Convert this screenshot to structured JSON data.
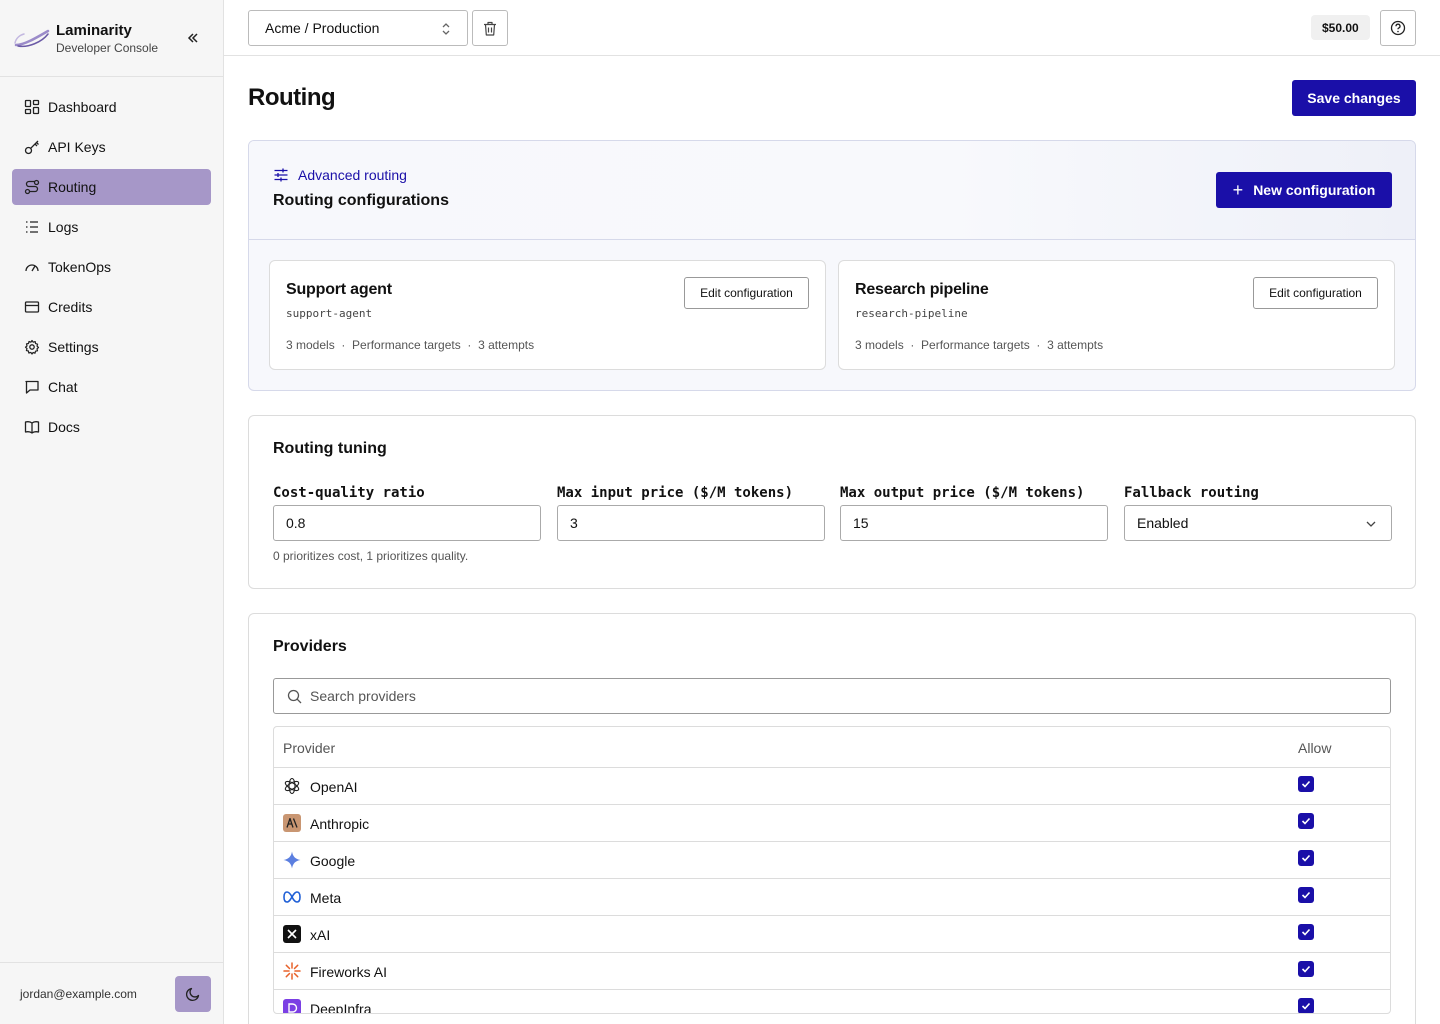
{
  "brand": {
    "title": "Laminarity",
    "subtitle": "Developer Console"
  },
  "nav": [
    {
      "label": "Dashboard",
      "icon": "dashboard-icon",
      "active": false
    },
    {
      "label": "API Keys",
      "icon": "key-icon",
      "active": false
    },
    {
      "label": "Routing",
      "icon": "routing-icon",
      "active": true
    },
    {
      "label": "Logs",
      "icon": "list-icon",
      "active": false
    },
    {
      "label": "TokenOps",
      "icon": "gauge-icon",
      "active": false
    },
    {
      "label": "Credits",
      "icon": "credit-card-icon",
      "active": false
    },
    {
      "label": "Settings",
      "icon": "gear-icon",
      "active": false
    },
    {
      "label": "Chat",
      "icon": "chat-icon",
      "active": false
    },
    {
      "label": "Docs",
      "icon": "book-icon",
      "active": false
    }
  ],
  "user": {
    "email": "jordan@example.com"
  },
  "topbar": {
    "project": "Acme / Production",
    "balance": "$50.00"
  },
  "page": {
    "title": "Routing",
    "save_label": "Save changes"
  },
  "advanced": {
    "label": "Advanced routing",
    "title": "Routing configurations",
    "new_label": "New configuration",
    "configs": [
      {
        "name": "Support agent",
        "slug": "support-agent",
        "meta": "3 models  ·  Performance targets  ·  3 attempts",
        "edit_label": "Edit configuration"
      },
      {
        "name": "Research pipeline",
        "slug": "research-pipeline",
        "meta": "3 models  ·  Performance targets  ·  3 attempts",
        "edit_label": "Edit configuration"
      }
    ]
  },
  "tuning": {
    "title": "Routing tuning",
    "fields": [
      {
        "label": "Cost-quality ratio",
        "value": "0.8"
      },
      {
        "label": "Max input price ($/M tokens)",
        "value": "3"
      },
      {
        "label": "Max output price ($/M tokens)",
        "value": "15"
      },
      {
        "label": "Fallback routing",
        "value": "Enabled"
      }
    ],
    "hint": "0 prioritizes cost, 1 prioritizes quality."
  },
  "providers": {
    "title": "Providers",
    "search_placeholder": "Search providers",
    "col_provider": "Provider",
    "col_allow": "Allow",
    "rows": [
      {
        "name": "OpenAI",
        "icon": "openai-icon",
        "allowed": true
      },
      {
        "name": "Anthropic",
        "icon": "anthropic-icon",
        "allowed": true
      },
      {
        "name": "Google",
        "icon": "google-icon",
        "allowed": true
      },
      {
        "name": "Meta",
        "icon": "meta-icon",
        "allowed": true
      },
      {
        "name": "xAI",
        "icon": "xai-icon",
        "allowed": true
      },
      {
        "name": "Fireworks AI",
        "icon": "fireworks-icon",
        "allowed": true
      },
      {
        "name": "DeepInfra",
        "icon": "deepinfra-icon",
        "allowed": true
      }
    ]
  },
  "colors": {
    "accent": "#1a0fa8",
    "nav_active": "#a697c8"
  }
}
